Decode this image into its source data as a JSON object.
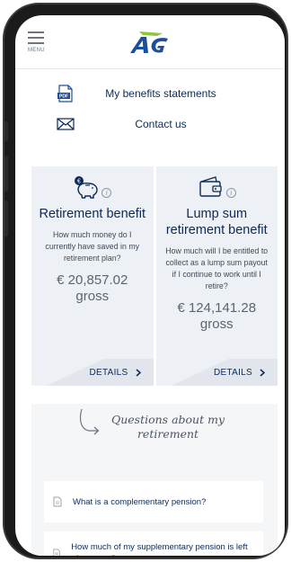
{
  "header": {
    "menu_label": "MENU",
    "logo_text": "AG"
  },
  "links": [
    {
      "label": "My benefits statements",
      "icon": "pdf-icon",
      "icon_text": "PDF"
    },
    {
      "label": "Contact us",
      "icon": "envelope-icon"
    }
  ],
  "cards": [
    {
      "title": "Retirement benefit",
      "icon": "piggy-bank-icon",
      "question": "How much money do I currently have saved in my retirement plan?",
      "amount": "€ 20,857.02",
      "gross": "gross",
      "details_label": "DETAILS"
    },
    {
      "title": "Lump sum retirement benefit",
      "icon": "wallet-icon",
      "question": "How much will I be entitled to collect as a lump sum payout if I continue to work until I retire?",
      "amount": "€ 124,141.28",
      "gross": "gross",
      "details_label": "DETAILS"
    }
  ],
  "questions": {
    "title": "Questions about my retirement",
    "items": [
      "What is a complementary pension?",
      "How much of my supplementary pension is left after taxes?"
    ]
  },
  "colors": {
    "navy": "#0c2a56",
    "logo_blue": "#1b4f9c",
    "logo_green": "#8cc63f",
    "card_bg": "#edf0f4"
  }
}
